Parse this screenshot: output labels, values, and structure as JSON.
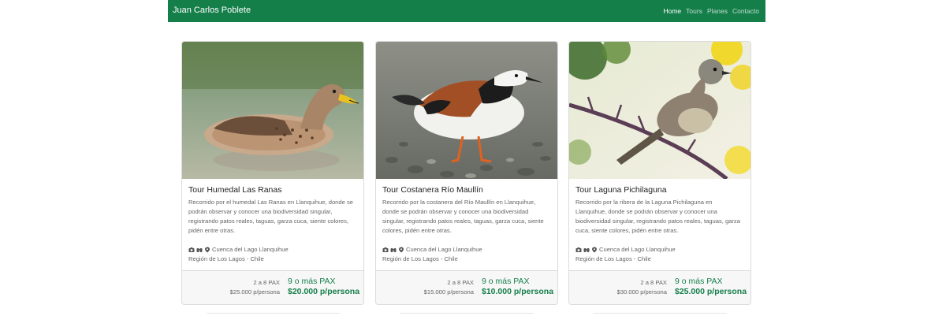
{
  "navbar": {
    "brand": "Juan Carlos Poblete",
    "links": [
      {
        "label": "Home",
        "active": true
      },
      {
        "label": "Tours",
        "active": false
      },
      {
        "label": "Planes",
        "active": false
      },
      {
        "label": "Contacto",
        "active": false
      }
    ]
  },
  "colors": {
    "brand_green": "#157f4a",
    "text_muted": "#666666"
  },
  "cards": [
    {
      "title": "Tour Humedal Las Ranas",
      "description": "Recorrido por el humedal Las Ranas en Llanquihue, donde se podrán observar y conocer una biodiversidad singular, registrando patos reales, taguas, garza cuca, siente colores, pidén entre otras.",
      "location_line1": "Cuenca del Lago Llanquihue",
      "location_line2": "Región de Los Lagos - Chile",
      "icons": [
        "camera-icon",
        "binoculars-icon",
        "map-marker-icon"
      ],
      "image_subject": "duck-photo",
      "price_small_group": "2 a 8 PAX",
      "price_small_value": "$25.000 p/persona",
      "price_large_group": "9 o más PAX",
      "price_large_value": "$20.000 p/persona"
    },
    {
      "title": "Tour Costanera Río Maullín",
      "description": "Recorrido por la costanera del Río Maullín en Llanquihue, donde se podrán observar y conocer una biodiversidad singular, registrando patos reales, taguas, garza cuca, siente colores, pidén entre otras.",
      "location_line1": "Cuenca del Lago Llanquihue",
      "location_line2": "Región de Los Lagos - Chile",
      "icons": [
        "camera-icon",
        "binoculars-icon",
        "map-marker-icon"
      ],
      "image_subject": "turnstone-photo",
      "price_small_group": "2 a 8 PAX",
      "price_small_value": "$15.000 p/persona",
      "price_large_group": "9 o más PAX",
      "price_large_value": "$10.000 p/persona"
    },
    {
      "title": "Tour Laguna Pichilaguna",
      "description": "Recorrido por la ribera de la Laguna Pichilaguna en Llanquihue, donde se podrán observar y conocer una biodiversidad singular, registrando patos reales, taguas, garza cuca, siente colores, pidén entre otras.",
      "location_line1": "Cuenca del Lago Llanquihue",
      "location_line2": "Región de Los Lagos - Chile",
      "icons": [
        "camera-icon",
        "binoculars-icon",
        "map-marker-icon"
      ],
      "image_subject": "flycatcher-photo",
      "price_small_group": "2 a 8 PAX",
      "price_small_value": "$30.000 p/persona",
      "price_large_group": "9 o más PAX",
      "price_large_value": "$25.000 p/persona"
    }
  ]
}
